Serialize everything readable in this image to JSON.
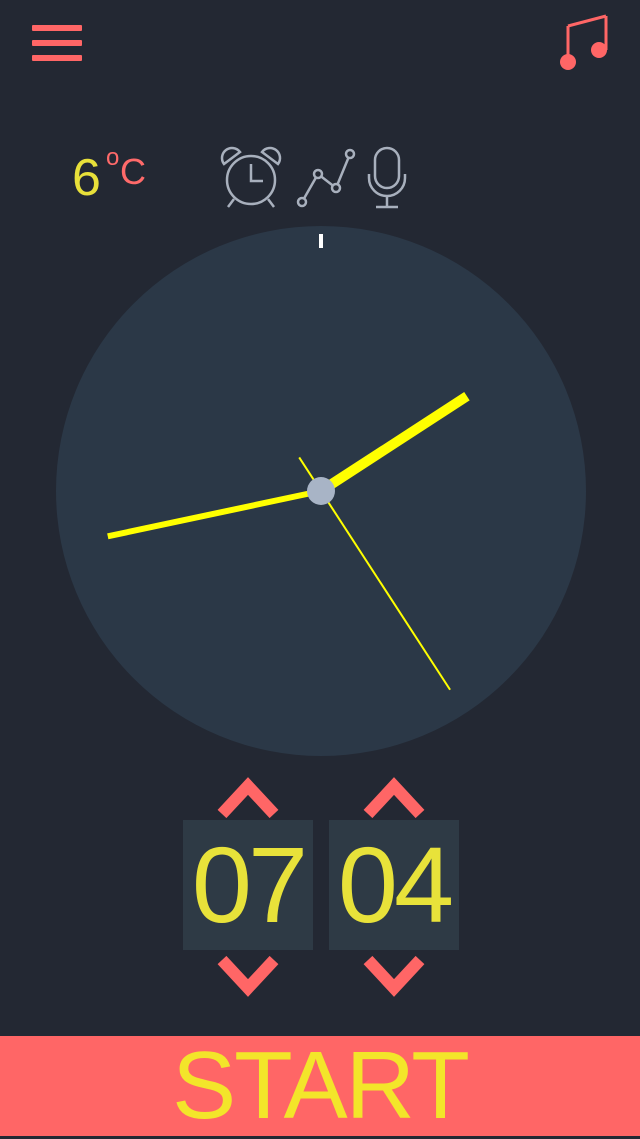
{
  "header": {
    "menu_icon": "hamburger-menu-icon",
    "music_icon": "music-note-icon"
  },
  "weather": {
    "temperature": "6",
    "degree_symbol": "o",
    "unit": "C"
  },
  "toolbar": {
    "icons": [
      "alarm-clock-icon",
      "line-graph-icon",
      "microphone-icon"
    ]
  },
  "clock": {
    "hour_hand_angle_deg": 57,
    "minute_hand_angle_deg": 258,
    "second_hand_angle_deg": 147
  },
  "time_picker": {
    "hours": "07",
    "minutes": "04"
  },
  "start_button": {
    "label": "START"
  },
  "colors": {
    "background": "#232833",
    "clock_face": "#2b3847",
    "accent_coral": "#ff6666",
    "hand_yellow": "#ffff00",
    "digit_yellow": "#e8e23a",
    "icon_gray": "#a8b0bd"
  }
}
